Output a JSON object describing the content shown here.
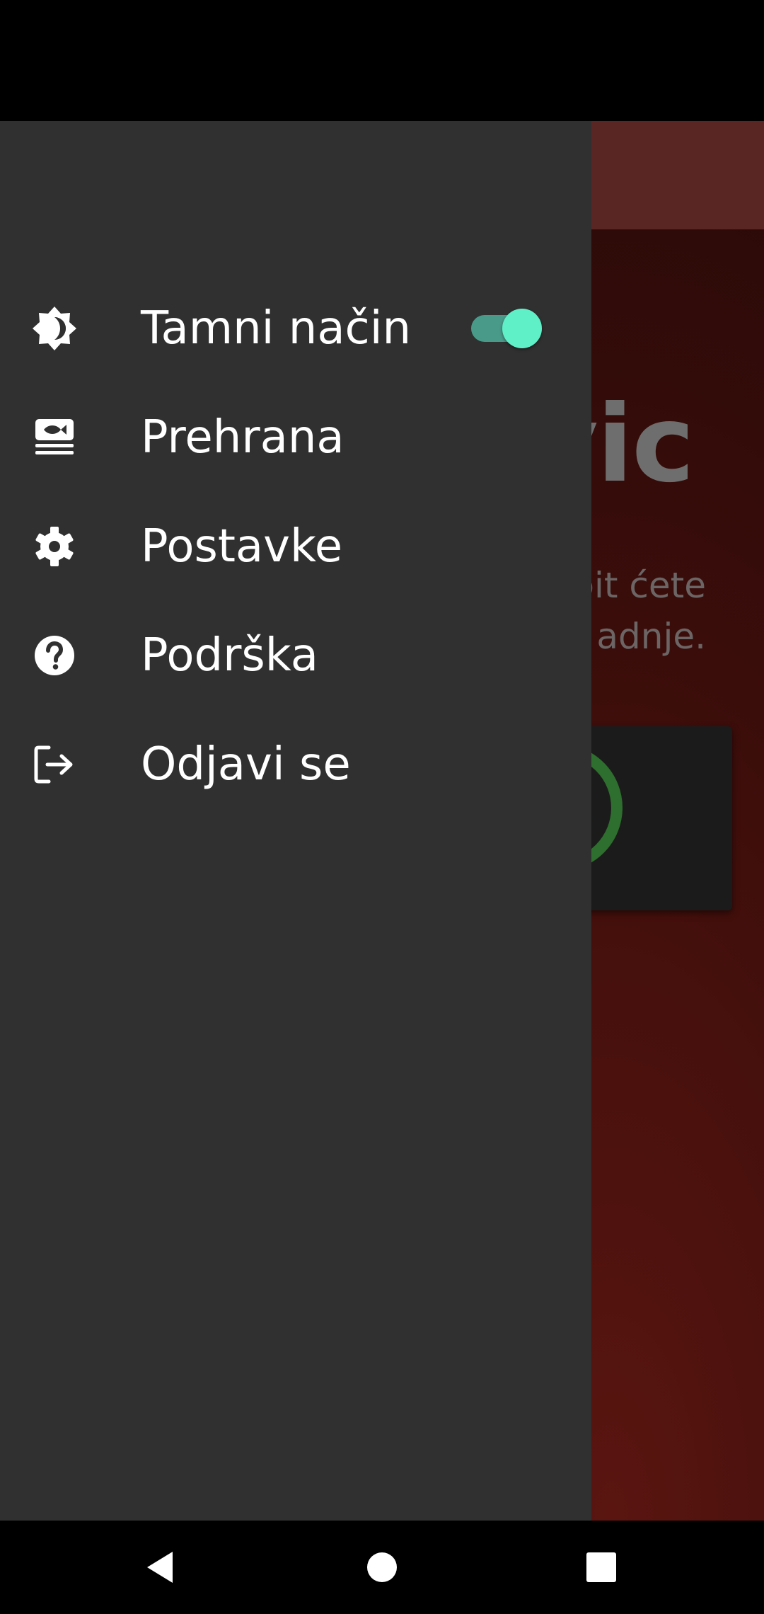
{
  "drawer": {
    "items": [
      {
        "label": "Tamni način",
        "icon": "dark-mode-icon",
        "toggle_on": true
      },
      {
        "label": "Prehrana",
        "icon": "nutrition-icon"
      },
      {
        "label": "Postavke",
        "icon": "gear-icon"
      },
      {
        "label": "Podrška",
        "icon": "help-icon"
      },
      {
        "label": "Odjavi se",
        "icon": "logout-icon"
      }
    ]
  },
  "background_app": {
    "title_fragment": "vic",
    "subtitle_line1": "bit ćete",
    "subtitle_line2": "adnje."
  },
  "colors": {
    "drawer_bg": "#303030",
    "toggle_accent": "#5ff0c8",
    "app_topbar": "#5a2624"
  },
  "nav": {
    "icons": [
      "back-icon",
      "home-icon",
      "recents-icon"
    ]
  }
}
